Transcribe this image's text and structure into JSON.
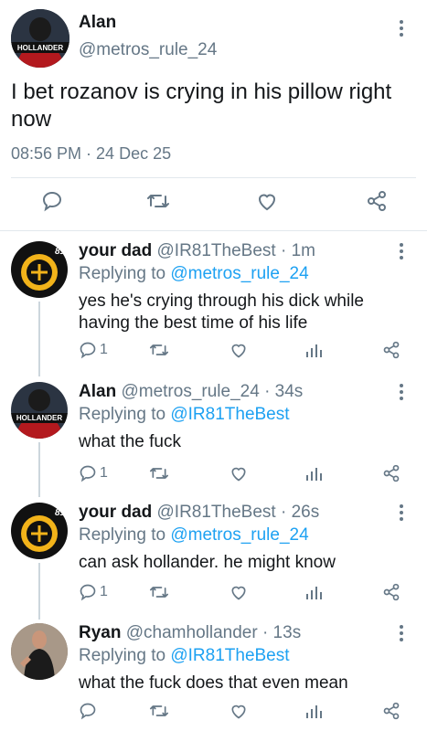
{
  "main_tweet": {
    "name": "Alan",
    "handle": "@metros_rule_24",
    "text": "I bet rozanov is crying in his pillow right now",
    "timestamp": "08:56 PM · 24 Dec 25",
    "avatar_text": "HOLLANDER",
    "actions": [
      "reply-icon",
      "retweet-icon",
      "like-icon",
      "share-icon"
    ]
  },
  "replies": [
    {
      "name": "your dad",
      "handle": "@IR81TheBest",
      "time": "· 1m",
      "replying_label": "Replying to",
      "replying_to": "@metros_rule_24",
      "text": "yes he's crying through his dick while having the best time of his life",
      "reply_count": "1",
      "avatar_text": "81"
    },
    {
      "name": "Alan",
      "handle": "@metros_rule_24",
      "time": "· 34s",
      "replying_label": "Replying to",
      "replying_to": "@IR81TheBest",
      "text": "what the fuck",
      "reply_count": "1",
      "avatar_text": "HOLLANDER"
    },
    {
      "name": "your dad",
      "handle": "@IR81TheBest",
      "time": "· 26s",
      "replying_label": "Replying to",
      "replying_to": "@metros_rule_24",
      "text": "can ask hollander. he might know",
      "reply_count": "1",
      "avatar_text": "81"
    },
    {
      "name": "Ryan",
      "handle": "@chamhollander",
      "time": "· 13s",
      "replying_label": "Replying to",
      "replying_to": "@IR81TheBest",
      "text": "what the fuck does that even mean",
      "reply_count": "",
      "avatar_text": ""
    }
  ],
  "colors": {
    "link": "#1da1f2",
    "secondary_text": "#657786",
    "divider": "#e1e8ed",
    "thread_line": "#ccd6dd"
  }
}
